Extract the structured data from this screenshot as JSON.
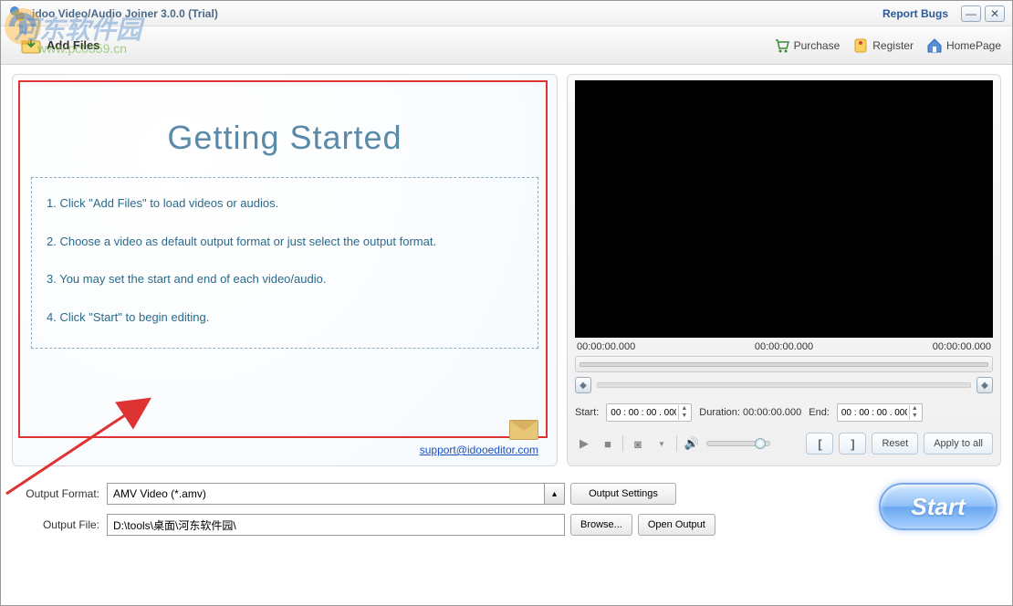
{
  "titlebar": {
    "title": "idoo Video/Audio Joiner 3.0.0 (Trial)",
    "report_bugs": "Report Bugs"
  },
  "toolbar": {
    "add_files": "Add Files",
    "purchase": "Purchase",
    "register": "Register",
    "homepage": "HomePage"
  },
  "getting_started": {
    "heading": "Getting Started",
    "steps": [
      "1. Click \"Add Files\" to load videos or audios.",
      "2. Choose a video as default output format or just select the output format.",
      "3. You may set the start and end of each video/audio.",
      "4. Click \"Start\" to begin editing."
    ],
    "support_email": "support@idooeditor.com"
  },
  "preview": {
    "time_left": "00:00:00.000",
    "time_mid": "00:00:00.000",
    "time_right": "00:00:00.000",
    "start_label": "Start:",
    "start_value": "00 : 00 : 00 . 000",
    "duration_label": "Duration:",
    "duration_value": "00:00:00.000",
    "end_label": "End:",
    "end_value": "00 : 00 : 00 . 000",
    "reset": "Reset",
    "apply_all": "Apply to all"
  },
  "output": {
    "format_label": "Output Format:",
    "format_value": "AMV Video (*.amv)",
    "settings": "Output Settings",
    "file_label": "Output File:",
    "file_value": "D:\\tools\\桌面\\河东软件园\\",
    "browse": "Browse...",
    "open_output": "Open Output"
  },
  "start_button": "Start",
  "watermark": {
    "main": "河东软件园",
    "sub": "www.pc0359.cn"
  }
}
